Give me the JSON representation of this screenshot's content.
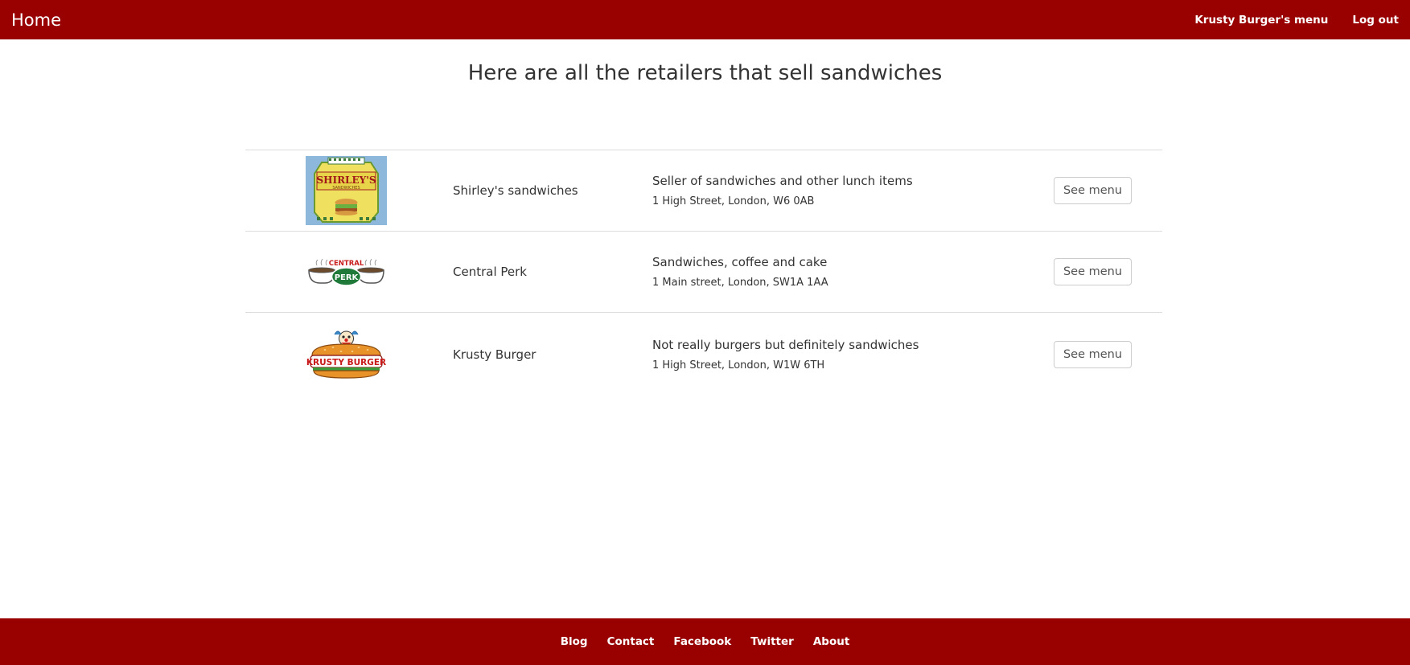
{
  "navbar": {
    "brand": "Home",
    "links": [
      "Krusty Burger's menu",
      "Log out"
    ],
    "background": "#990000"
  },
  "page": {
    "title": "Here are all the retailers that sell sandwiches"
  },
  "retailers": [
    {
      "logo_icon": "shirleys-sandwiches-logo",
      "logo_text": "SHIRLEY'S",
      "logo_subtext": "SANDWICHES",
      "name": "Shirley's sandwiches",
      "description": "Seller of sandwiches and other lunch items",
      "address": "1 High Street, London, W6 0AB",
      "button": "See menu"
    },
    {
      "logo_icon": "central-perk-logo",
      "logo_text": "CENTRAL",
      "logo_subtext": "PERK",
      "name": "Central Perk",
      "description": "Sandwiches, coffee and cake",
      "address": "1 Main street, London, SW1A 1AA",
      "button": "See menu"
    },
    {
      "logo_icon": "krusty-burger-logo",
      "logo_text": "KRUSTY BURGER",
      "name": "Krusty Burger",
      "description": "Not really burgers but definitely sandwiches",
      "address": "1 High Street, London, W1W 6TH",
      "button": "See menu"
    }
  ],
  "footer": {
    "links": [
      "Blog",
      "Contact",
      "Facebook",
      "Twitter",
      "About"
    ],
    "background": "#990000"
  }
}
